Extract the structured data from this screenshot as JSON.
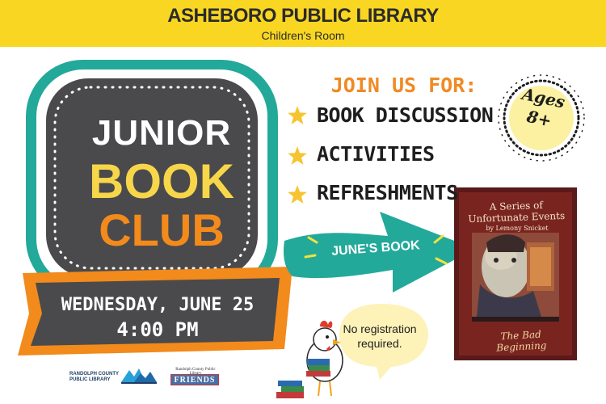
{
  "banner": {
    "title": "ASHEBORO PUBLIC LIBRARY",
    "subtitle": "Children's Room",
    "color": "#f9d622"
  },
  "club": {
    "line1": "JUNIOR",
    "line2": "BOOK",
    "line3": "CLUB"
  },
  "event": {
    "day_date": "WEDNESDAY, JUNE 25",
    "time": "4:00 PM"
  },
  "activities": {
    "heading": "JOIN US FOR:",
    "items": [
      "BOOK DISCUSSION",
      "ACTIVITIES",
      "REFRESHMENTS"
    ]
  },
  "ages": {
    "line1": "Ages",
    "line2": "8+"
  },
  "arrow": {
    "label": "JUNE'S BOOK"
  },
  "registration": {
    "line1": "No registration",
    "line2": "required."
  },
  "book": {
    "title_line1": "A Series of",
    "title_line2": "Unfortunate Events",
    "author": "by Lemony Snicket",
    "subtitle": "The Bad Beginning"
  },
  "logos": {
    "county_line1": "RANDOLPH COUNTY",
    "county_line2": "PUBLIC LIBRARY",
    "friends_caption": "Randolph County Public Library",
    "friends_word": "FRIENDS"
  },
  "colors": {
    "teal": "#23a99a",
    "dark_panel": "#4a4a4c",
    "orange": "#f28a1c",
    "yellow_text": "#f7d64a",
    "star": "#f6c431"
  }
}
